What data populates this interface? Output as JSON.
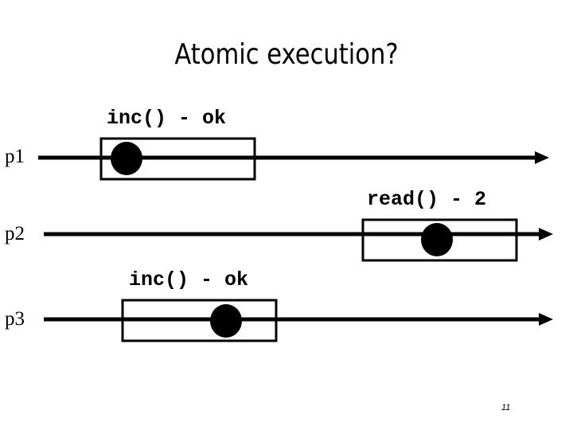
{
  "title": "Atomic execution?",
  "processes": [
    {
      "label": "p1",
      "operation": "inc() - ok"
    },
    {
      "label": "p2",
      "operation": "read() - 2"
    },
    {
      "label": "p3",
      "operation": "inc() - ok"
    }
  ],
  "page_number": "11"
}
